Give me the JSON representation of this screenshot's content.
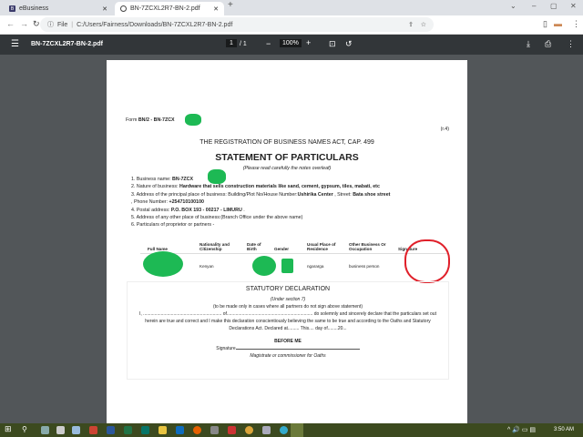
{
  "browser": {
    "tabs": [
      {
        "label": "eBusiness",
        "icon": "bootstrap-icon"
      },
      {
        "label": "BN-7ZCXL2R7-BN-2.pdf",
        "icon": "globe-icon",
        "active": true
      }
    ],
    "address": {
      "scheme_label": "File",
      "url": "C:/Users/Fairness/Downloads/BN-7ZCXL2R7-BN-2.pdf"
    }
  },
  "pdf_toolbar": {
    "filename": "BN-7ZCXL2R7-BN-2.pdf",
    "page_current": "1",
    "page_total": "/ 1",
    "zoom": "100%"
  },
  "document": {
    "form_label": "Form ",
    "form_code": "BN/2 - BN-7ZCX",
    "ref": "(r.4)",
    "act_title": "THE REGISTRATION OF BUSINESS NAMES ACT, CAP. 499",
    "heading": "STATEMENT OF PARTICULARS",
    "subheading": "(Please read carefully the notes overleaf)",
    "items": [
      {
        "label": "1.  Business name: ",
        "value": "BN-7ZCX"
      },
      {
        "label": "2.  Nature of business: ",
        "value": "Hardware that sells construction materials like sand, cement, gypsum, tiles, mabati, etc"
      },
      {
        "label": "3.  Address of the principal place of business: Building/Plot No/House Number:",
        "value": "Ushirika Center",
        "label2": " , Street: ",
        "value2": "Bata shoe street"
      },
      {
        "label": "     , Phone Number: ",
        "value": "+254710100100"
      },
      {
        "label": "4.  Postal address: ",
        "value": "P.O. BOX 193 - 00217 - LIMURU",
        "suffix": " ."
      },
      {
        "label": "5.  Address of any other place of business:(Branch Office under the above name)"
      },
      {
        "label": "6.  Particulars of proprietor or partners -"
      }
    ],
    "table": {
      "headers": [
        "Full Name",
        "Nationality and Citizenship",
        "Date of Birth",
        "Gender",
        "Usual Place of Residence",
        "Other Business Or Occupation",
        "Signature"
      ],
      "row": [
        "",
        "Kenyan",
        "",
        "",
        "ngararga",
        "business person",
        ""
      ]
    },
    "declaration": {
      "title": "STATUTORY DECLARATION",
      "section": "(Under section 7)",
      "note": "(to be made only in cases where all partners do not sign above statement)",
      "body": "I, .............................................................. of.................................................................... do solemnly and sincerely declare that the particulars set out herein are true and correct and I make this declaration conscientiously believing the same to be true and according to the Oaths and Statutory Declarations Act. Declared at......... This.... day of........20...",
      "before": "BEFORE ME",
      "signature": "Signature",
      "magistrate": "Magistrate or commissioner for Oaths"
    }
  },
  "taskbar": {
    "time": "3:50 AM"
  },
  "colors": {
    "redaction": "#1db954",
    "annotation": "#e0202a",
    "toolbar": "#323639",
    "viewer_bg": "#525659"
  }
}
